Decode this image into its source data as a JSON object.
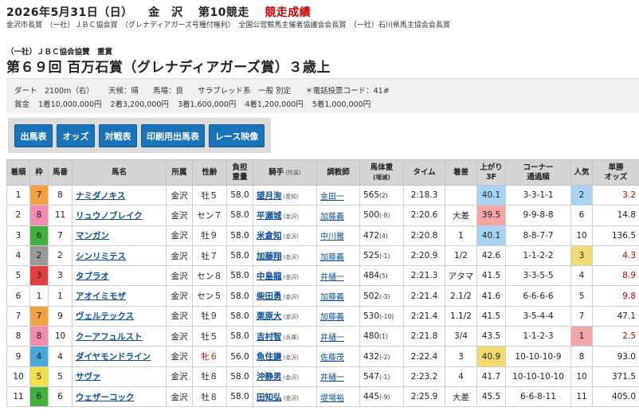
{
  "header": {
    "date": "2026年5月31日（日）",
    "venue": "金　沢",
    "race_no": "第10競走",
    "result_label": "競走成績"
  },
  "sponsor": "金沢市長賞　（一社）ＪＢＣ協会賞　（グレナディアガーズ号種付権利）　全国公営競馬主催者協議会会長賞　（一社）石川県馬主協会会長賞",
  "race": {
    "subtitle": "（一社）ＪＢＣ協会協賛　重賞",
    "title": "第６９回 百万石賞（グレナディアガーズ賞）３歳上"
  },
  "conditions": {
    "line1": [
      "ダート　2100m（右）",
      "天候：晴",
      "馬場：良",
      "サラブレッド系　一般 別定",
      "＊電話投票コード：41#"
    ],
    "prize_label": "賞金",
    "prizes": [
      "1着10,000,000円",
      "2着3,200,000円",
      "3着1,600,000円",
      "4着1,200,000円",
      "5着1,000,000円"
    ]
  },
  "buttons": [
    "出馬表",
    "オッズ",
    "対戦表",
    "印刷用出馬表",
    "レース映像"
  ],
  "table": {
    "headers": {
      "rank": "着順",
      "waku": "枠",
      "umaban": "馬番",
      "horse": "馬名",
      "stable": "所属",
      "sexage": "性齢",
      "burden1": "負担",
      "burden2": "重量",
      "jockey": "騎手",
      "jockey_sub": "(所属)",
      "trainer": "調教師",
      "weight1": "馬体重",
      "weight2": "(増減)",
      "time": "タイム",
      "margin": "着差",
      "last3f1": "上がり",
      "last3f2": "3F",
      "corner1": "コーナー",
      "corner2": "通過順",
      "pop": "人気",
      "odds1": "単勝",
      "odds2": "オッズ"
    },
    "rows": [
      {
        "rank": "1",
        "waku": "7",
        "umaban": "8",
        "horse": "ナミダノキス",
        "stable": "金沢",
        "sexage": "牡５",
        "burden": "58.0",
        "jockey": "望月洵",
        "jaff": "(愛知)",
        "trainer": "金田一",
        "bw": "565",
        "bwd": "(2)",
        "time": "2:18.3",
        "margin": "",
        "last3f": "40.1",
        "corner": "3-3-1-1",
        "pop": "2",
        "odds": "3.2"
      },
      {
        "rank": "2",
        "waku": "8",
        "umaban": "11",
        "horse": "リュウノブレイク",
        "stable": "金沢",
        "sexage": "セン７",
        "burden": "58.0",
        "jockey": "平瀬城",
        "jaff": "(金沢)",
        "trainer": "加藤義",
        "bw": "500",
        "bwd": "(-8)",
        "time": "2:20.6",
        "margin": "大差",
        "last3f": "39.5",
        "corner": "9-9-8-8",
        "pop": "6",
        "odds": "14.8"
      },
      {
        "rank": "3",
        "waku": "6",
        "umaban": "7",
        "horse": "マンガン",
        "stable": "金沢",
        "sexage": "牡９",
        "burden": "58.0",
        "jockey": "米倉知",
        "jaff": "(金沢)",
        "trainer": "中川雅",
        "bw": "472",
        "bwd": "(4)",
        "time": "2:20.8",
        "margin": "1",
        "last3f": "40.1",
        "corner": "8-8-7-7",
        "pop": "10",
        "odds": "136.5"
      },
      {
        "rank": "4",
        "waku": "2",
        "umaban": "2",
        "horse": "シンリミテス",
        "stable": "金沢",
        "sexage": "牡７",
        "burden": "58.0",
        "jockey": "加藤翔",
        "jaff": "(金沢)",
        "trainer": "加藤義",
        "bw": "525",
        "bwd": "(-1)",
        "time": "2:20.9",
        "margin": "1/2",
        "last3f": "42.6",
        "corner": "1-1-2-2",
        "pop": "3",
        "odds": "4.3"
      },
      {
        "rank": "5",
        "waku": "3",
        "umaban": "3",
        "horse": "タブラオ",
        "stable": "金沢",
        "sexage": "セン８",
        "burden": "58.0",
        "jockey": "中島龍",
        "jaff": "(金沢)",
        "trainer": "井樋一",
        "bw": "484",
        "bwd": "(5)",
        "time": "2:21.3",
        "margin": "アタマ",
        "last3f": "41.5",
        "corner": "3-3-5-5",
        "pop": "4",
        "odds": "8.9"
      },
      {
        "rank": "6",
        "waku": "1",
        "umaban": "1",
        "horse": "アオイミモザ",
        "stable": "金沢",
        "sexage": "セン５",
        "burden": "58.0",
        "jockey": "柴田勇",
        "jaff": "(金沢)",
        "trainer": "加藤義",
        "bw": "502",
        "bwd": "(-3)",
        "time": "2:21.4",
        "margin": "2.1/2",
        "last3f": "41.6",
        "corner": "6-6-6-6",
        "pop": "5",
        "odds": "9.8"
      },
      {
        "rank": "7",
        "waku": "7",
        "umaban": "9",
        "horse": "ヴェルテックス",
        "stable": "金沢",
        "sexage": "牡９",
        "burden": "58.0",
        "jockey": "栗原大",
        "jaff": "(金沢)",
        "trainer": "加藤義",
        "bw": "530",
        "bwd": "(-10)",
        "time": "2:21.4",
        "margin": "1.1/2",
        "last3f": "41.5",
        "corner": "3-5-4-4",
        "pop": "7",
        "odds": "47.1"
      },
      {
        "rank": "8",
        "waku": "8",
        "umaban": "10",
        "horse": "クーアフュルスト",
        "stable": "金沢",
        "sexage": "牡５",
        "burden": "58.0",
        "jockey": "吉村智",
        "jaff": "(兵庫)",
        "trainer": "井樋一",
        "bw": "480",
        "bwd": "(1)",
        "time": "2:21.8",
        "margin": "3/4",
        "last3f": "43.5",
        "corner": "1-1-2-3",
        "pop": "1",
        "odds": "2.5"
      },
      {
        "rank": "9",
        "waku": "4",
        "umaban": "4",
        "horse": "ダイヤモンドライン",
        "stable": "金沢",
        "sexage": "牝６",
        "burden": "56.0",
        "jockey": "魚住謙",
        "jaff": "(金沢)",
        "trainer": "佐藤茂",
        "bw": "432",
        "bwd": "(-2)",
        "time": "2:22.4",
        "margin": "3",
        "last3f": "40.9",
        "corner": "10-10-10-9",
        "pop": "8",
        "odds": "93.0"
      },
      {
        "rank": "10",
        "waku": "5",
        "umaban": "5",
        "horse": "サヴァ",
        "stable": "金沢",
        "sexage": "牡８",
        "burden": "58.0",
        "jockey": "沖静男",
        "jaff": "(金沢)",
        "trainer": "井樋一",
        "bw": "547",
        "bwd": "(-1)",
        "time": "2:23.2",
        "margin": "4",
        "last3f": "41.7",
        "corner": "10-10-10-10",
        "pop": "10",
        "odds": "371.5"
      },
      {
        "rank": "11",
        "waku": "6",
        "umaban": "6",
        "horse": "ウェザーコック",
        "stable": "金沢",
        "sexage": "牡８",
        "burden": "58.0",
        "jockey": "田知弘",
        "jaff": "(金沢)",
        "trainer": "堤場裕",
        "bw": "445",
        "bwd": "(-9)",
        "time": "2:25.9",
        "margin": "大差",
        "last3f": "45.5",
        "corner": "6-6-8-11",
        "pop": "11",
        "odds": "405.0"
      }
    ]
  },
  "colors": {
    "waku": {
      "1": "#ffffff",
      "2": "#999999",
      "3": "#e04040",
      "4": "#4aa8d8",
      "5": "#f0e050",
      "6": "#40b040",
      "7": "#f2a040",
      "8": "#f08cb0"
    },
    "last3f_rank1": "#f4a6a6",
    "last3f_rank2": "#a6d4f2",
    "last3f_rank3": "#f0dc70",
    "pop1": "#f4a6a6",
    "pop2": "#a6d4f2",
    "pop3": "#f0dc70",
    "odds_red": "#cc0000"
  }
}
